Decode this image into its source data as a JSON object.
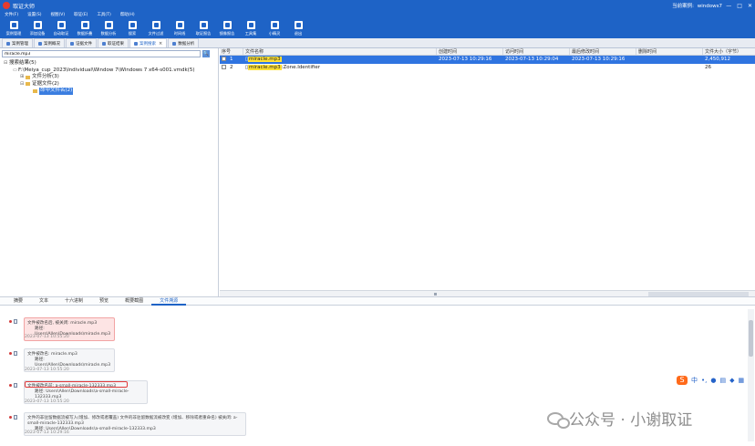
{
  "window": {
    "title": "取证大师",
    "case_label": "当前案例:",
    "case_name": "windows7",
    "controls": [
      "—",
      "□",
      "✕"
    ]
  },
  "menu": [
    "文件(F)",
    "设置(S)",
    "视图(V)",
    "取证(E)",
    "工具(T)",
    "帮助(H)"
  ],
  "toolbar": [
    {
      "label": "案例管理",
      "icon": "case-management-icon"
    },
    {
      "label": "添加设备",
      "icon": "add-device-icon"
    },
    {
      "label": "自动取证",
      "icon": "auto-forensics-icon"
    },
    {
      "label": "数据折叠",
      "icon": "data-fold-icon"
    },
    {
      "label": "数据分析",
      "icon": "data-analysis-icon"
    },
    {
      "label": "搜索",
      "icon": "search-icon"
    },
    {
      "label": "文件过滤",
      "icon": "file-filter-icon"
    },
    {
      "label": "时间线",
      "icon": "timeline-icon"
    },
    {
      "label": "取证报告",
      "icon": "report-icon"
    },
    {
      "label": "镜像报告",
      "icon": "image-report-icon"
    },
    {
      "label": "工具集",
      "icon": "toolset-icon"
    },
    {
      "label": "小精灵",
      "icon": "sprite-icon"
    },
    {
      "label": "退出",
      "icon": "exit-icon"
    }
  ],
  "tabs": [
    {
      "label": "案例管理",
      "active": false
    },
    {
      "label": "案例概况",
      "active": false
    },
    {
      "label": "证据文件",
      "active": false
    },
    {
      "label": "取证结果",
      "active": false
    },
    {
      "label": "案例搜索",
      "active": true,
      "closable": true
    },
    {
      "label": "数据分析",
      "active": false
    }
  ],
  "left": {
    "search_value": "miracle.mp3",
    "search_button": "🔍",
    "tree": [
      {
        "toggle": "⊟",
        "label": "搜索结果(5)"
      },
      {
        "toggle": "",
        "label": "F:\\Meiya_cup_2023\\Individual\\Window 7\\Windows 7 x64-s001.vmdk(5)"
      },
      {
        "toggle": "⊞",
        "label": "文件分析(3)"
      },
      {
        "toggle": "⊟",
        "label": "证据文件(2)"
      },
      {
        "toggle": "",
        "label": "命中文件名(2)"
      }
    ]
  },
  "table": {
    "columns": [
      "序号",
      "文件名称",
      "",
      "创建时间",
      "访问时间",
      "最后修改时间",
      "删除时间",
      "",
      "文件大小（字节）"
    ],
    "rows": [
      {
        "num": "1",
        "name_hl": "miracle.mp3",
        "name_rest": "",
        "created": "2023-07-13 10:29:16",
        "accessed": "2023-07-13 10:29:04",
        "modified": "2023-07-13 10:29:16",
        "deleted": "",
        "size": "2,450,912"
      },
      {
        "num": "2",
        "name_hl": "miracle.mp3",
        "name_rest": ":Zone.Identifier",
        "created": "",
        "accessed": "",
        "modified": "",
        "deleted": "",
        "size": "26"
      }
    ]
  },
  "bottom_tabs": [
    {
      "label": "摘要",
      "active": false
    },
    {
      "label": "文本",
      "active": false
    },
    {
      "label": "十六进制",
      "active": false
    },
    {
      "label": "预览",
      "active": false
    },
    {
      "label": "概要截图",
      "active": false
    },
    {
      "label": "文件溯源",
      "active": true
    }
  ],
  "trace": [
    {
      "line1": "文件被改名后, 被关闭: miracle.mp3",
      "line2": "路径: Users\\Allen\\Downloads\\miracle.mp3",
      "time": "2023-07-13 10:55:20",
      "style": "red"
    },
    {
      "line1": "文件被改名: miracle.mp3",
      "line2": "路径: Users\\Allen\\Downloads\\miracle.mp3",
      "time": "2023-07-13 10:55:20",
      "style": "gray"
    },
    {
      "line1": "文件被改名前: a-small-miracle-132333.mp3",
      "line2": "路径: Users\\Allen\\Downloads\\a-small-miracle-132333.mp3",
      "time": "2023-07-13 10:55:20",
      "style": "gray"
    },
    {
      "line1": "文件的非驻留数据流被写入(增加、修改或者覆盖) 文件的非驻留数据流被改变 (增加、移除或者重命名) 被关闭: a-small-miracle-132333.mp3",
      "line2": "路径: Users\\Allen\\Downloads\\a-small-miracle-132333.mp3",
      "time": "2023-07-13 10:29:16",
      "style": "gray"
    }
  ],
  "ime": {
    "logo": "S",
    "mode": "中",
    "extra": "•,"
  },
  "watermark": "公众号 · 小谢取证"
}
